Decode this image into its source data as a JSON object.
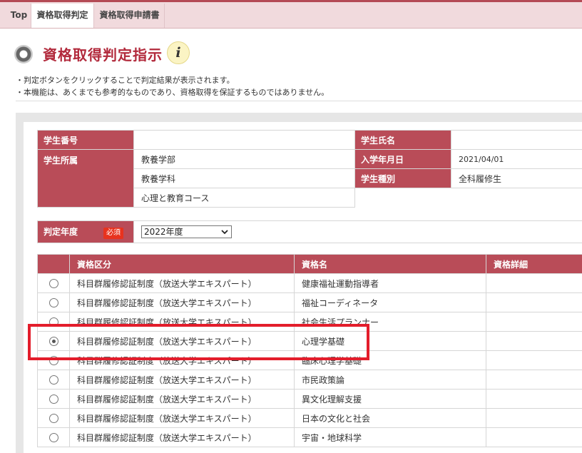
{
  "tabs": [
    {
      "label": "Top"
    },
    {
      "label": "資格取得判定"
    },
    {
      "label": "資格取得申請書"
    }
  ],
  "heading": {
    "title": "資格取得判定指示",
    "info_glyph": "i"
  },
  "notes": [
    "・判定ボタンをクリックすることで判定結果が表示されます。",
    "・本機能は、あくまでも参考的なものであり、資格取得を保証するものではありません。"
  ],
  "student": {
    "number_label": "学生番号",
    "number_value": "",
    "name_label": "学生氏名",
    "name_value": "",
    "affiliation_label": "学生所属",
    "affiliation_lines": [
      "教養学部",
      "教養学科",
      "心理と教育コース"
    ],
    "enroll_label": "入学年月日",
    "enroll_value": "2021/04/01",
    "type_label": "学生種別",
    "type_value": "全科履修生"
  },
  "year": {
    "label": "判定年度",
    "required": "必須",
    "selected": "2022年度"
  },
  "list": {
    "headers": [
      "資格区分",
      "資格名",
      "資格詳細"
    ],
    "rows": [
      {
        "category": "科目群履修認証制度（放送大学エキスパート）",
        "name": "健康福祉運動指導者",
        "detail": "",
        "selected": false
      },
      {
        "category": "科目群履修認証制度（放送大学エキスパート）",
        "name": "福祉コーディネータ",
        "detail": "",
        "selected": false
      },
      {
        "category": "科目群履修認証制度（放送大学エキスパート）",
        "name": "社会生活プランナー",
        "detail": "",
        "selected": false
      },
      {
        "category": "科目群履修認証制度（放送大学エキスパート）",
        "name": "心理学基礎",
        "detail": "",
        "selected": true
      },
      {
        "category": "科目群履修認証制度（放送大学エキスパート）",
        "name": "臨床心理学基礎",
        "detail": "",
        "selected": false
      },
      {
        "category": "科目群履修認証制度（放送大学エキスパート）",
        "name": "市民政策論",
        "detail": "",
        "selected": false
      },
      {
        "category": "科目群履修認証制度（放送大学エキスパート）",
        "name": "異文化理解支援",
        "detail": "",
        "selected": false
      },
      {
        "category": "科目群履修認証制度（放送大学エキスパート）",
        "name": "日本の文化と社会",
        "detail": "",
        "selected": false
      },
      {
        "category": "科目群履修認証制度（放送大学エキスパート）",
        "name": "宇宙・地球科学",
        "detail": "",
        "selected": false
      }
    ]
  },
  "colors": {
    "accent": "#b94c58",
    "title": "#b22a3c",
    "highlight": "#e31d2b",
    "required": "#e8321e"
  }
}
